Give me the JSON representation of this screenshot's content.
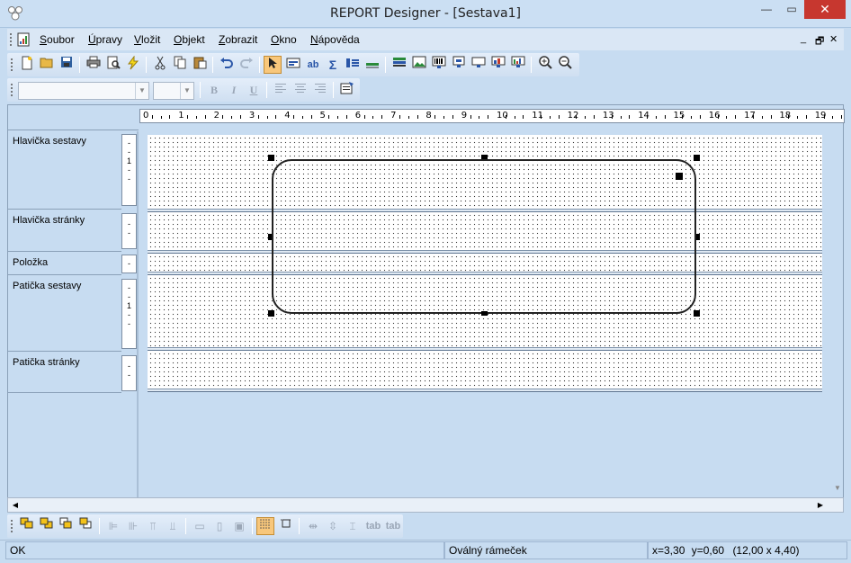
{
  "window": {
    "title": "REPORT Designer - [Sestava1]"
  },
  "menubar": {
    "items": [
      {
        "label": "Soubor",
        "key": "S",
        "rest": "oubor"
      },
      {
        "label": "Úpravy",
        "key": "Ú",
        "rest": "pravy"
      },
      {
        "label": "Vložit",
        "key": "V",
        "rest": "ložit"
      },
      {
        "label": "Objekt",
        "key": "O",
        "rest": "bjekt"
      },
      {
        "label": "Zobrazit",
        "key": "Z",
        "rest": "obrazit"
      },
      {
        "label": "Okno",
        "key": "O",
        "rest": "kno"
      },
      {
        "label": "Nápověda",
        "key": "N",
        "rest": "ápověda"
      }
    ]
  },
  "format_toolbar": {
    "font_name": "",
    "font_size": "",
    "bold": "B",
    "italic": "I",
    "underline": "U"
  },
  "ruler": {
    "labels": [
      "0",
      "1",
      "2",
      "3",
      "4",
      "5",
      "6",
      "7",
      "8",
      "9",
      "10",
      "11",
      "12",
      "13",
      "14",
      "15",
      "16",
      "17",
      "18",
      "19"
    ]
  },
  "sections": [
    {
      "label": "Hlavička sestavy",
      "ruler_marks": "-\n-\n1\n-\n-"
    },
    {
      "label": "Hlavička stránky",
      "ruler_marks": "-\n-"
    },
    {
      "label": "Položka",
      "ruler_marks": "-"
    },
    {
      "label": "Patička sestavy",
      "ruler_marks": "-\n-\n1\n-\n-"
    },
    {
      "label": "Patička stránky",
      "ruler_marks": "-\n-"
    }
  ],
  "bottom_toolbar": {
    "tab_left": "tab",
    "tab_right": "tab"
  },
  "status": {
    "state": "OK",
    "object": "Oválný rámeček",
    "x": "x=3,30",
    "y": "y=0,60",
    "size": "(12,00 x 4,40)"
  },
  "colors": {
    "selection_pressed": "#f8c77b",
    "close_button": "#c7372f",
    "chrome": "#c7dcf1"
  }
}
